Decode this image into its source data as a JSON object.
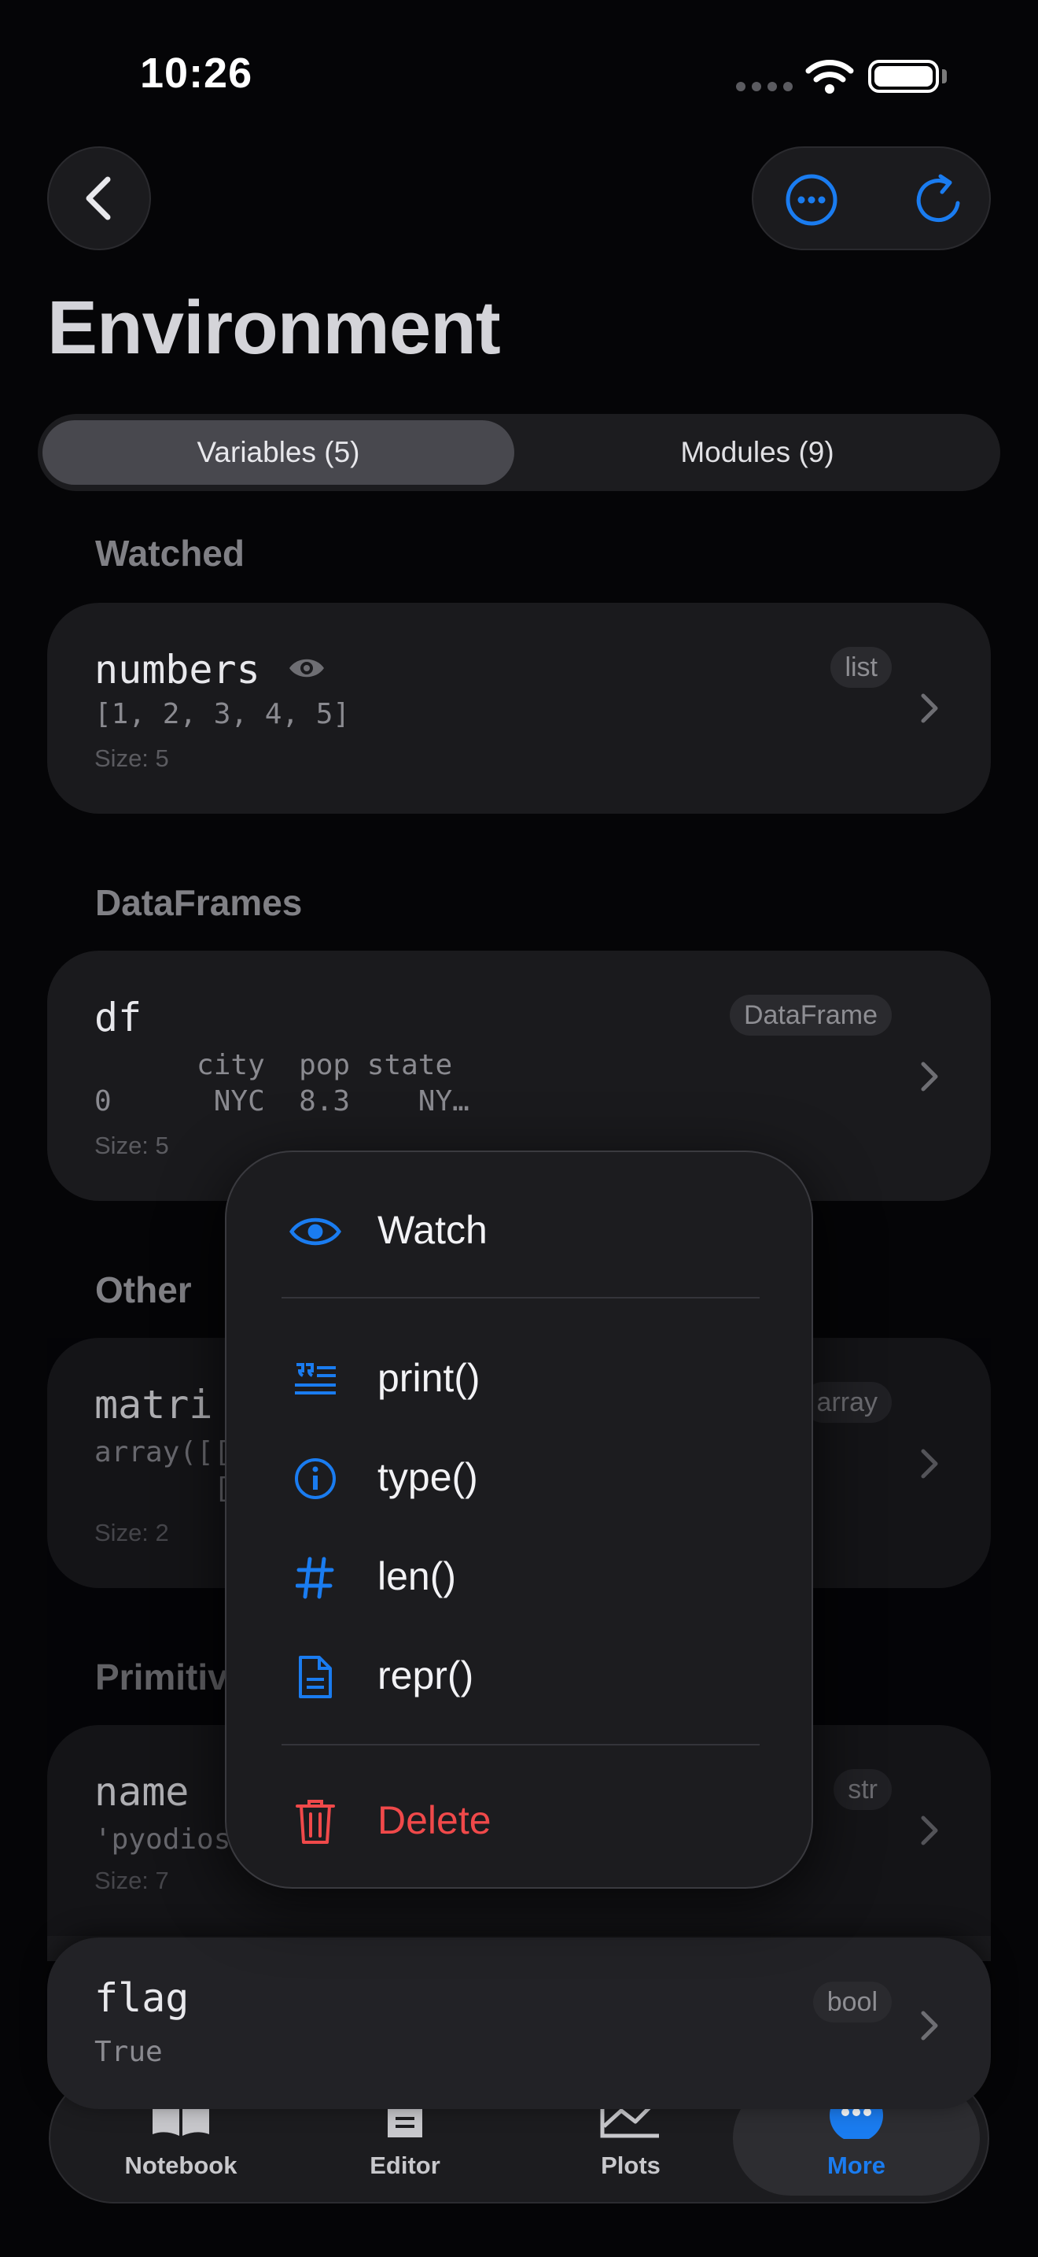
{
  "status": {
    "time": "10:26"
  },
  "title": "Environment",
  "segments": {
    "variables": "Variables (5)",
    "modules": "Modules (9)",
    "selected": "Variables (5)"
  },
  "sections": {
    "watched": "Watched",
    "dataframes": "DataFrames",
    "other": "Other",
    "primitives": "Primitiv"
  },
  "variables": {
    "numbers": {
      "name": "numbers",
      "type": "list",
      "value": "[1, 2, 3, 4, 5]",
      "size": "Size: 5"
    },
    "df": {
      "name": "df",
      "type": "DataFrame",
      "value_line1": "      city  pop state",
      "value_line2": "0      NYC  8.3    NY…",
      "size": "Size: 5"
    },
    "matrix": {
      "name": "matri",
      "type": "array",
      "value_line1": "array([[",
      "value_line2": "       [",
      "size": "Size: 2"
    },
    "name": {
      "name": "name",
      "type": "str",
      "value": "'pyodios",
      "size": "Size: 7"
    },
    "flag": {
      "name": "flag",
      "type": "bool",
      "value": "True"
    }
  },
  "context_menu": {
    "watch": "Watch",
    "print": "print()",
    "type": "type()",
    "len": "len()",
    "repr": "repr()",
    "delete": "Delete"
  },
  "tabs": [
    {
      "label": "Notebook",
      "icon": "book-icon"
    },
    {
      "label": "Editor",
      "icon": "document-icon"
    },
    {
      "label": "Plots",
      "icon": "chart-icon"
    },
    {
      "label": "More",
      "icon": "ellipsis-circle-icon"
    }
  ],
  "active_tab": "More",
  "colors": {
    "accent": "#1a7cf0",
    "danger": "#f0494a",
    "background": "#050507",
    "card": "#1a1a1d"
  }
}
